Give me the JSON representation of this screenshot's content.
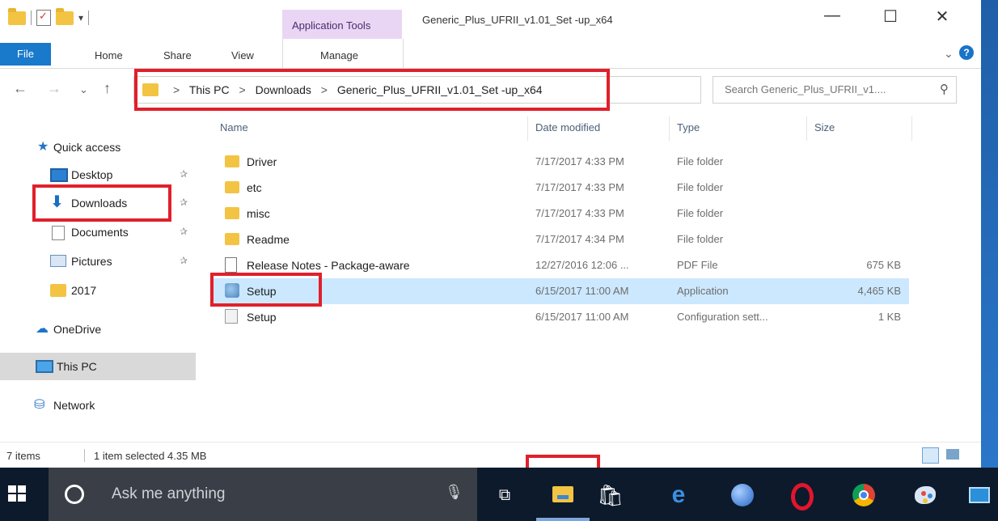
{
  "window": {
    "title": "Generic_Plus_UFRII_v1.01_Set -up_x64",
    "contextual_group": "Application Tools",
    "controls": {
      "minimize": "—",
      "maximize": "☐",
      "close": "✕"
    }
  },
  "ribbon": {
    "tabs": [
      "File",
      "Home",
      "Share",
      "View"
    ],
    "manage_tab": "Manage"
  },
  "address": {
    "crumbs": [
      "This PC",
      "Downloads",
      "Generic_Plus_UFRII_v1.01_Set -up_x64"
    ],
    "separator": ">",
    "search_placeholder": "Search Generic_Plus_UFRII_v1...."
  },
  "nav": {
    "quick_access": "Quick access",
    "items": [
      {
        "label": "Desktop",
        "icon": "desktop-icon",
        "pinned": true
      },
      {
        "label": "Downloads",
        "icon": "download-arrow-icon",
        "pinned": true
      },
      {
        "label": "Documents",
        "icon": "documents-icon",
        "pinned": true
      },
      {
        "label": "Pictures",
        "icon": "pictures-icon",
        "pinned": true
      },
      {
        "label": "2017",
        "icon": "folder-icon",
        "pinned": false
      }
    ],
    "onedrive": "OneDrive",
    "this_pc": "This PC",
    "network": "Network",
    "pin_glyph": "✰"
  },
  "files": {
    "columns": [
      "Name",
      "Date modified",
      "Type",
      "Size"
    ],
    "rows": [
      {
        "name": "Driver",
        "date": "7/17/2017 4:33 PM",
        "type": "File folder",
        "size": "",
        "icon": "folder-icon",
        "selected": false
      },
      {
        "name": "etc",
        "date": "7/17/2017 4:33 PM",
        "type": "File folder",
        "size": "",
        "icon": "folder-icon",
        "selected": false
      },
      {
        "name": "misc",
        "date": "7/17/2017 4:33 PM",
        "type": "File folder",
        "size": "",
        "icon": "folder-icon",
        "selected": false
      },
      {
        "name": "Readme",
        "date": "7/17/2017 4:34 PM",
        "type": "File folder",
        "size": "",
        "icon": "folder-icon",
        "selected": false
      },
      {
        "name": "Release Notes - Package-aware",
        "date": "12/27/2016 12:06 ...",
        "type": "PDF File",
        "size": "675 KB",
        "icon": "pdf-icon",
        "selected": false
      },
      {
        "name": "Setup",
        "date": "6/15/2017 11:00 AM",
        "type": "Application",
        "size": "4,465 KB",
        "icon": "setup-app-icon",
        "selected": true
      },
      {
        "name": "Setup",
        "date": "6/15/2017 11:00 AM",
        "type": "Configuration sett...",
        "size": "1 KB",
        "icon": "config-file-icon",
        "selected": false
      }
    ]
  },
  "status": {
    "count": "7 items",
    "selection": "1 item selected  4.35 MB"
  },
  "taskbar": {
    "search_placeholder": "Ask me anything",
    "pinned": [
      "task-view-icon",
      "file-explorer-icon",
      "store-icon",
      "edge-icon",
      "globe-browser-icon",
      "opera-icon",
      "chrome-icon",
      "paint-icon",
      "app-icon"
    ],
    "active": "file-explorer-icon"
  },
  "colors": {
    "highlight_box": "#e0202b",
    "selected_row": "#cce8ff",
    "file_tab": "#1979ca",
    "application_tools": "#e9d6f5",
    "taskbar": "#0c1a2b"
  }
}
